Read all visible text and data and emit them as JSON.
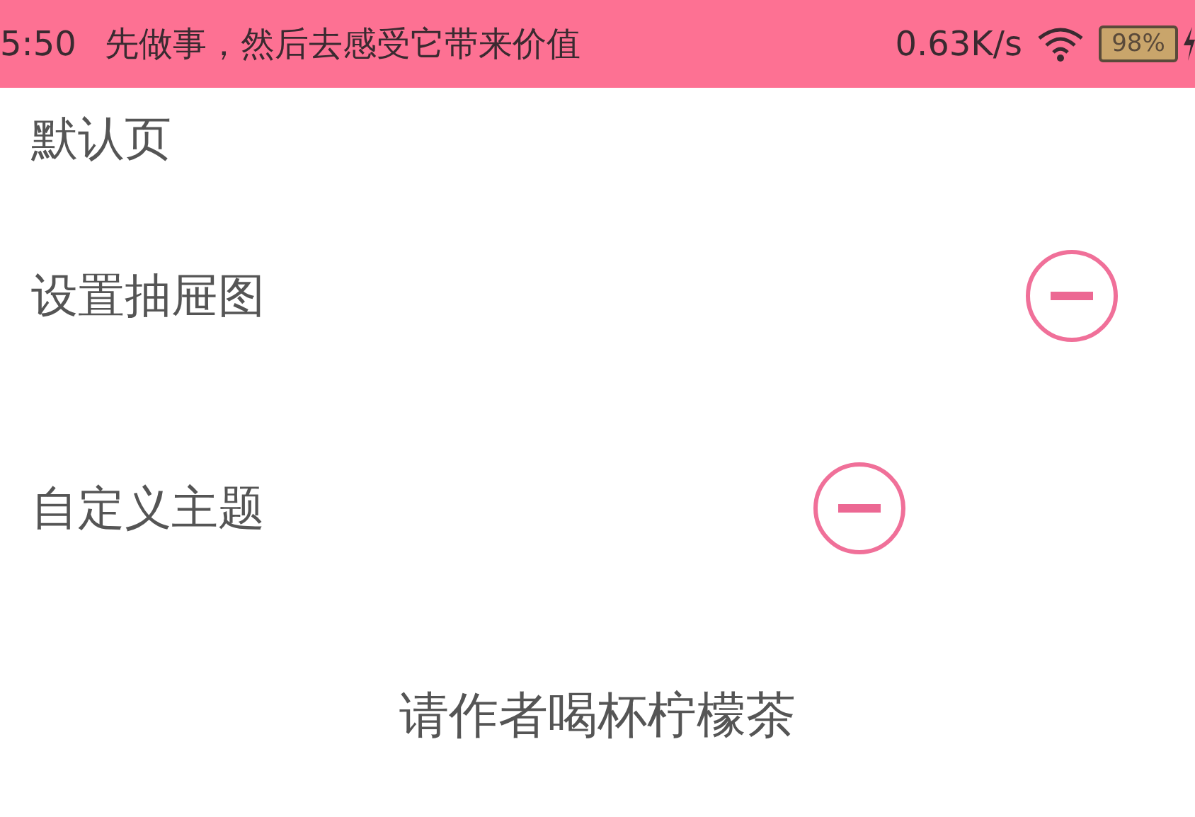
{
  "status_bar": {
    "time": "5:50",
    "message": "先做事，然后去感受它带来价值",
    "speed": "0.63K/s",
    "battery": "98%"
  },
  "items": [
    {
      "label": "默认页",
      "kind": "plain"
    },
    {
      "label": "设置抽屉图",
      "kind": "minus"
    },
    {
      "label": "自定义主题",
      "kind": "minus"
    }
  ],
  "footer_link": "请作者喝杯柠檬茶"
}
